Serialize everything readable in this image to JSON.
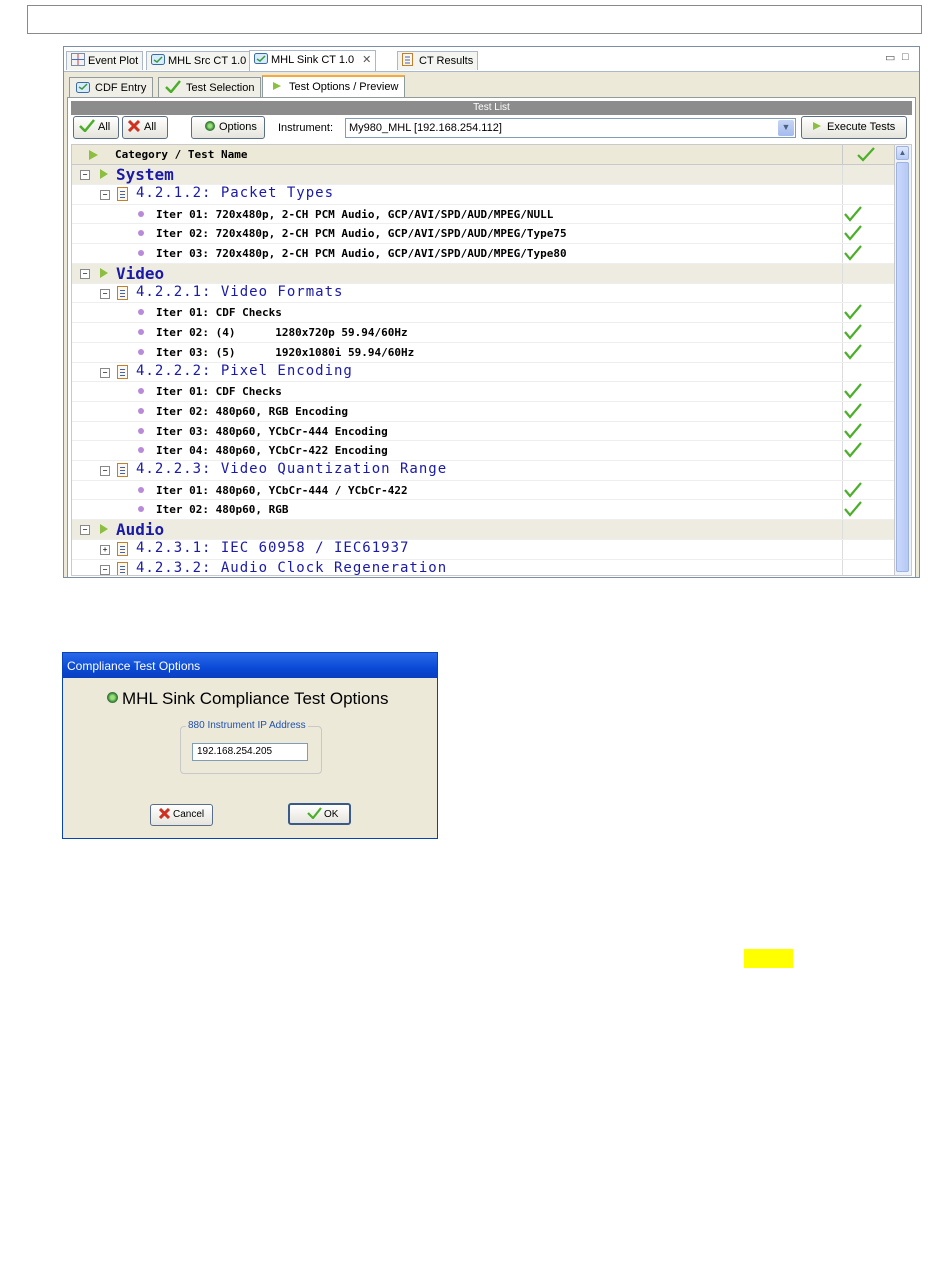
{
  "view_tabs": [
    {
      "label": "Event Plot",
      "icon": "event-plot-icon"
    },
    {
      "label": "MHL Src CT 1.0",
      "icon": "ct-icon"
    },
    {
      "label": "MHL Sink CT 1.0",
      "icon": "ct-icon"
    },
    {
      "label": "CT Results",
      "icon": "doc-icon"
    }
  ],
  "sub_tabs": [
    {
      "label": "CDF Entry"
    },
    {
      "label": "Test Selection"
    },
    {
      "label": "Test Options / Preview"
    }
  ],
  "test_list": {
    "title": "Test List",
    "select_all_label": "All",
    "deselect_all_label": "All",
    "options_label": "Options",
    "instrument_label": "Instrument:",
    "instrument_value": "My980_MHL [192.168.254.112]",
    "execute_label": "Execute Tests",
    "column_header": "Category / Test Name"
  },
  "tree": [
    {
      "type": "cat",
      "label": "System"
    },
    {
      "type": "test",
      "label": "4.2.1.2: Packet Types",
      "expanded": true
    },
    {
      "type": "iter",
      "label": "Iter 01: 720x480p, 2-CH PCM Audio, GCP/AVI/SPD/AUD/MPEG/NULL",
      "checked": true
    },
    {
      "type": "iter",
      "label": "Iter 02: 720x480p, 2-CH PCM Audio, GCP/AVI/SPD/AUD/MPEG/Type75",
      "checked": true
    },
    {
      "type": "iter",
      "label": "Iter 03: 720x480p, 2-CH PCM Audio, GCP/AVI/SPD/AUD/MPEG/Type80",
      "checked": true
    },
    {
      "type": "cat",
      "label": "Video"
    },
    {
      "type": "test",
      "label": "4.2.2.1: Video Formats",
      "expanded": true
    },
    {
      "type": "iter",
      "label": "Iter 01: CDF Checks",
      "checked": true
    },
    {
      "type": "iter",
      "label": "Iter 02: (4)      1280x720p 59.94/60Hz",
      "checked": true
    },
    {
      "type": "iter",
      "label": "Iter 03: (5)      1920x1080i 59.94/60Hz",
      "checked": true
    },
    {
      "type": "test",
      "label": "4.2.2.2: Pixel Encoding",
      "expanded": true
    },
    {
      "type": "iter",
      "label": "Iter 01: CDF Checks",
      "checked": true
    },
    {
      "type": "iter",
      "label": "Iter 02: 480p60, RGB Encoding",
      "checked": true
    },
    {
      "type": "iter",
      "label": "Iter 03: 480p60, YCbCr-444 Encoding",
      "checked": true
    },
    {
      "type": "iter",
      "label": "Iter 04: 480p60, YCbCr-422 Encoding",
      "checked": true
    },
    {
      "type": "test",
      "label": "4.2.2.3: Video Quantization Range",
      "expanded": true
    },
    {
      "type": "iter",
      "label": "Iter 01: 480p60, YCbCr-444 / YCbCr-422",
      "checked": true
    },
    {
      "type": "iter",
      "label": "Iter 02: 480p60, RGB",
      "checked": true
    },
    {
      "type": "cat",
      "label": "Audio"
    },
    {
      "type": "test",
      "label": "4.2.3.1: IEC 60958 / IEC61937",
      "expanded": false
    },
    {
      "type": "test",
      "label": "4.2.3.2: Audio Clock Regeneration",
      "expanded": true
    }
  ],
  "dialog": {
    "title": "Compliance Test Options",
    "heading": "MHL Sink Compliance Test Options",
    "group_label": "880 Instrument IP Address",
    "ip_value": "192.168.254.205",
    "cancel_label": "Cancel",
    "ok_label": "OK"
  },
  "colors": {
    "accent_blue": "#1a1aa8",
    "check_green": "#4caf2a",
    "highlight": "#ffff00",
    "title_bar": "#0a4ad6"
  }
}
